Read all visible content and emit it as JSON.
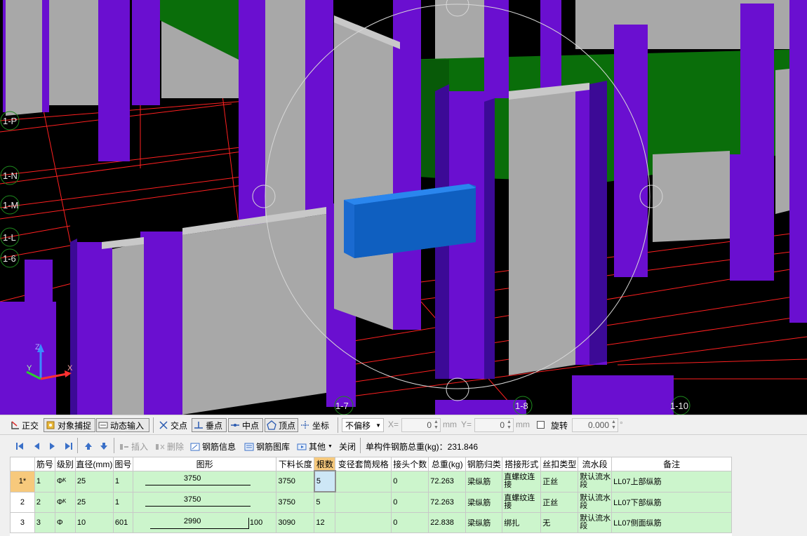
{
  "viewport": {
    "axis_labels": [
      "1-P",
      "1-N",
      "1-M",
      "1-L",
      "1-6",
      "1-7",
      "1-8",
      "1-10"
    ],
    "colors": {
      "background": "#000000",
      "wall": "#a8a8a8",
      "wall_top": "#c8c8c8",
      "column": "#6a0fd0",
      "column_dark": "#3c0a96",
      "beam_green": "#0a6e0a",
      "beam_selected": "#1a78e0",
      "gridline": "#ff2020"
    },
    "gizmo_labels": {
      "x": "X",
      "y": "Y",
      "z": "Z"
    }
  },
  "toolbar1": {
    "ortho": "正交",
    "snap": "对象捕捉",
    "dynamic_input": "动态输入",
    "intersection": "交点",
    "perpendicular": "垂点",
    "midpoint": "中点",
    "vertex": "顶点",
    "coordinate": "坐标",
    "offset_select": "不偏移",
    "x_label": "X=",
    "x_value": "0",
    "x_unit": "mm",
    "y_label": "Y=",
    "y_value": "0",
    "y_unit": "mm",
    "rotate_label": "旋转",
    "rotate_value": "0.000",
    "rotate_unit": "°"
  },
  "toolbar2": {
    "insert": "插入",
    "delete": "删除",
    "rebar_info": "钢筋信息",
    "rebar_library": "钢筋图库",
    "other": "其他",
    "close": "关闭",
    "total_weight": "单构件钢筋总重(kg)：231.846"
  },
  "table": {
    "headers": [
      "筋号",
      "级别",
      "直径(mm)",
      "图号",
      "图形",
      "下料长度",
      "根数",
      "变径套筒规格",
      "接头个数",
      "总重(kg)",
      "钢筋归类",
      "搭接形式",
      "丝扣类型",
      "流水段",
      "备注"
    ],
    "rows": [
      {
        "row_no": "1*",
        "bar_no": "1",
        "grade": "Φᴷ",
        "diameter": "25",
        "fig_no": "1",
        "shape_main": "3750",
        "shape_end": "",
        "cut_length": "3750",
        "count": "5",
        "sleeve": "",
        "joints": "0",
        "weight": "72.263",
        "category": "梁纵筋",
        "splice": "直螺纹连接",
        "thread": "正丝",
        "segment": "默认流水段",
        "remark": "LL07上部纵筋"
      },
      {
        "row_no": "2",
        "bar_no": "2",
        "grade": "Φᴷ",
        "diameter": "25",
        "fig_no": "1",
        "shape_main": "3750",
        "shape_end": "",
        "cut_length": "3750",
        "count": "5",
        "sleeve": "",
        "joints": "0",
        "weight": "72.263",
        "category": "梁纵筋",
        "splice": "直螺纹连接",
        "thread": "正丝",
        "segment": "默认流水段",
        "remark": "LL07下部纵筋"
      },
      {
        "row_no": "3",
        "bar_no": "3",
        "grade": "Φ",
        "diameter": "10",
        "fig_no": "601",
        "shape_main": "2990",
        "shape_end": "100",
        "cut_length": "3090",
        "count": "12",
        "sleeve": "",
        "joints": "0",
        "weight": "22.838",
        "category": "梁纵筋",
        "splice": "绑扎",
        "thread": "无",
        "segment": "默认流水段",
        "remark": "LL07侧面纵筋"
      }
    ]
  }
}
